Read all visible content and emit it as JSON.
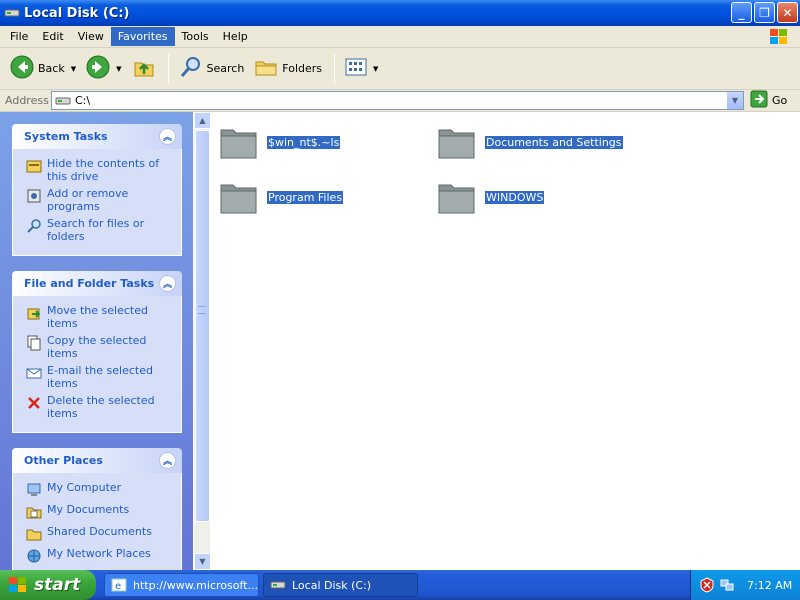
{
  "window": {
    "title": "Local Disk (C:)",
    "buttons": {
      "minimize": "_",
      "maximize": "❐",
      "close": "✕"
    }
  },
  "menubar": {
    "items": [
      "File",
      "Edit",
      "View",
      "Favorites",
      "Tools",
      "Help"
    ],
    "active": "Favorites"
  },
  "toolbar": {
    "back": "Back",
    "search": "Search",
    "folders": "Folders"
  },
  "address": {
    "label": "Address",
    "value": "C:\\",
    "go": "Go"
  },
  "sidebar": {
    "system_tasks": {
      "title": "System Tasks",
      "items": [
        {
          "label": "Hide the contents of this drive",
          "icon": "hide-contents-icon"
        },
        {
          "label": "Add or remove programs",
          "icon": "add-remove-programs-icon"
        },
        {
          "label": "Search for files or folders",
          "icon": "search-icon"
        }
      ]
    },
    "file_folder_tasks": {
      "title": "File and Folder Tasks",
      "items": [
        {
          "label": "Move the selected items",
          "icon": "move-icon"
        },
        {
          "label": "Copy the selected items",
          "icon": "copy-icon"
        },
        {
          "label": "E-mail the selected items",
          "icon": "email-icon"
        },
        {
          "label": "Delete the selected items",
          "icon": "delete-icon"
        }
      ]
    },
    "other_places": {
      "title": "Other Places",
      "items": [
        {
          "label": "My Computer",
          "icon": "my-computer-icon"
        },
        {
          "label": "My Documents",
          "icon": "my-documents-icon"
        },
        {
          "label": "Shared Documents",
          "icon": "shared-documents-icon"
        },
        {
          "label": "My Network Places",
          "icon": "network-places-icon"
        }
      ]
    }
  },
  "content": {
    "folders": [
      {
        "name": "$win_nt$.~ls",
        "selected": true
      },
      {
        "name": "Documents and Settings",
        "selected": true
      },
      {
        "name": "Program Files",
        "selected": true
      },
      {
        "name": "WINDOWS",
        "selected": true
      }
    ]
  },
  "taskbar": {
    "start": "start",
    "tasks": [
      {
        "label": "http://www.microsoft....",
        "active": false
      },
      {
        "label": "Local Disk (C:)",
        "active": true
      }
    ],
    "clock": "7:12 AM"
  },
  "colors": {
    "titlebar": "#0053e0",
    "selection": "#316ac5",
    "sidebar_link": "#215dc6",
    "start_green": "#3ca63c"
  }
}
